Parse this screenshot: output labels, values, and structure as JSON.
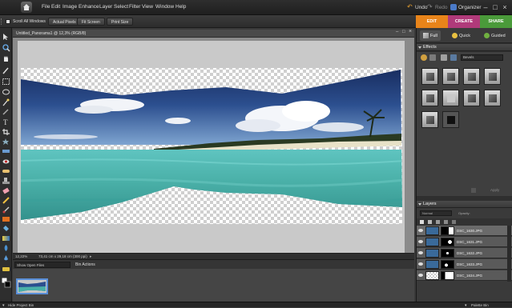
{
  "menubar": {
    "items": [
      "File",
      "Edit",
      "Image",
      "Enhance",
      "Layer",
      "Select",
      "Filter",
      "View",
      "Window",
      "Help"
    ],
    "undo": "Undo",
    "redo": "Redo",
    "organizer": "Organizer"
  },
  "optbar": {
    "scroll_all": "Scroll All Windows",
    "actual_pixels": "Actual Pixels",
    "fit_screen": "Fit Screen",
    "print_size": "Print Size"
  },
  "mode_tabs": [
    {
      "label": "EDIT",
      "color": "#e8841a"
    },
    {
      "label": "CREATE",
      "color": "#b03a7a"
    },
    {
      "label": "SHARE",
      "color": "#4a9a3a"
    }
  ],
  "edit_tabs": {
    "full": "Full",
    "quick": "Quick",
    "guided": "Guided"
  },
  "document": {
    "title": "Untitled_Panorama1 @ 12,3% (RGB/8)",
    "zoom": "12,22%",
    "dimensions": "73,41 cm x 29,18 cm (300 ppi)"
  },
  "bin": {
    "show_select": "Show Open Files",
    "actions": "Bin Actions"
  },
  "bottom": {
    "hide_bin": "Hide Project Bin",
    "palette_bin": "Palette Bin"
  },
  "effects": {
    "title": "Effects",
    "style": "Bevels",
    "apply": "Apply"
  },
  "layers": {
    "title": "Layers",
    "blend": "Normal",
    "opacity": "Opacity:",
    "items": [
      {
        "name": "DSC_1630.JPG"
      },
      {
        "name": "DSC_1631.JPG"
      },
      {
        "name": "DSC_1632.JPG"
      },
      {
        "name": "DSC_1633.JPG"
      },
      {
        "name": "DSC_1634.JPG"
      }
    ]
  }
}
